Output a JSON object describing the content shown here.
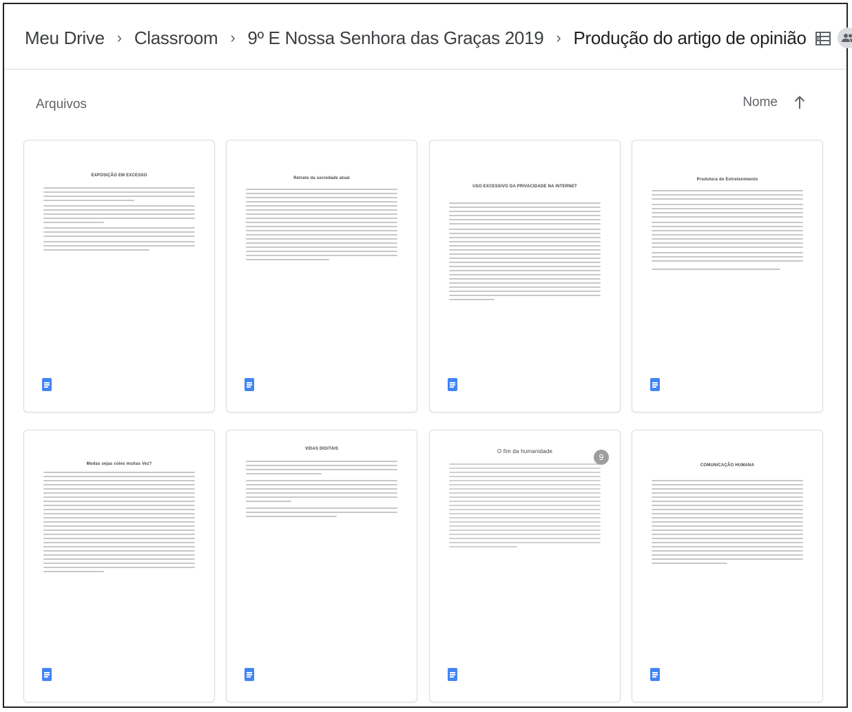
{
  "breadcrumb": {
    "items": [
      "Meu Drive",
      "Classroom",
      "9º E Nossa Senhora das Graças 2019",
      "Produção do artigo de opinião"
    ],
    "separator": "›",
    "dropdown_icon": "caret-down-icon"
  },
  "toolbar": {
    "shared_icon": "people-icon",
    "view_toggle_icon": "list-view-icon"
  },
  "section": {
    "title": "Arquivos",
    "sort_label": "Nome",
    "sort_direction_icon": "arrow-up-icon"
  },
  "files": [
    {
      "doc_title": "EXPOSIÇÃO EM EXCESSO",
      "type_icon": "google-docs-icon"
    },
    {
      "doc_title": "Retrato da sociedade atual",
      "type_icon": "google-docs-icon"
    },
    {
      "doc_title": "USO EXCESSIVO DA PRIVACIDADE NA INTERNET",
      "type_icon": "google-docs-icon"
    },
    {
      "doc_title": "Produtora do Entretenimento",
      "type_icon": "google-docs-icon"
    },
    {
      "doc_title": "Modas sejas coles muitas Vez?",
      "type_icon": "google-docs-icon"
    },
    {
      "doc_title": "VIDAS DIGITAIS",
      "type_icon": "google-docs-icon"
    },
    {
      "doc_title": "O fim da humanidade",
      "type_icon": "google-docs-icon",
      "badge": "9"
    },
    {
      "doc_title": "COMUNICAÇÃO HUMANA",
      "type_icon": "google-docs-icon"
    }
  ],
  "colors": {
    "docs_blue": "#4285f4",
    "border": "#dadce0",
    "text": "#3c4043"
  }
}
